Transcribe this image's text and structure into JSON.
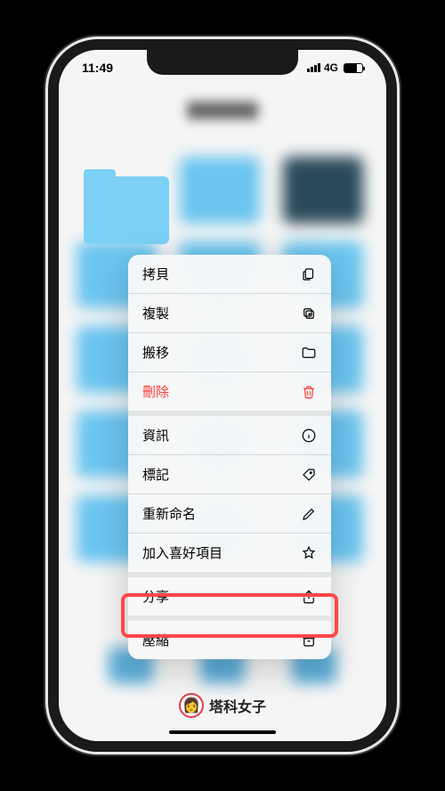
{
  "status": {
    "time": "11:49",
    "network": "4G"
  },
  "menu": {
    "items": [
      {
        "label": "拷貝",
        "icon": "copy-doc",
        "destructive": false
      },
      {
        "label": "複製",
        "icon": "duplicate",
        "destructive": false
      },
      {
        "label": "搬移",
        "icon": "folder",
        "destructive": false
      },
      {
        "label": "刪除",
        "icon": "trash",
        "destructive": true
      },
      {
        "label": "資訊",
        "icon": "info",
        "destructive": false
      },
      {
        "label": "標記",
        "icon": "tag",
        "destructive": false
      },
      {
        "label": "重新命名",
        "icon": "pencil",
        "destructive": false
      },
      {
        "label": "加入喜好項目",
        "icon": "star",
        "destructive": false
      },
      {
        "label": "分享",
        "icon": "share",
        "destructive": false
      },
      {
        "label": "壓縮",
        "icon": "archive",
        "destructive": false
      }
    ]
  },
  "watermark": {
    "text": "塔科女子"
  },
  "highlight": {
    "target_index": 9
  }
}
